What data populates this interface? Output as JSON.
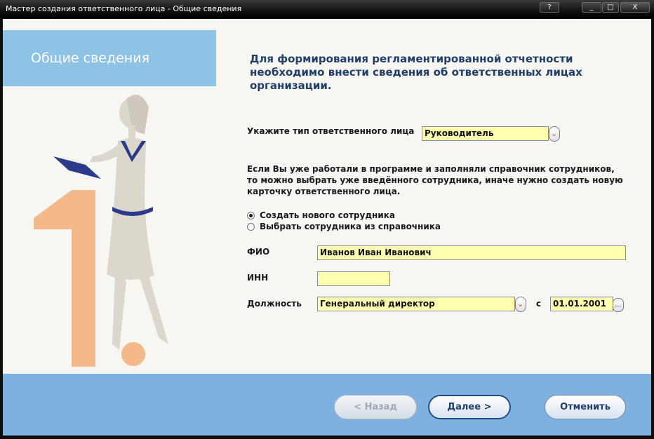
{
  "window": {
    "title": "Мастер создания ответственного лица - Общие сведения",
    "help_label": "?",
    "min_label": "_",
    "max_label": "□",
    "close_label": "X"
  },
  "header": {
    "title": "Общие сведения"
  },
  "intro": {
    "text": "Для формирования регламентированной отчетности необходимо внести сведения об ответственных лицах организации."
  },
  "responsible_type": {
    "label": "Укажите тип ответственного лица",
    "value": "Руководитель"
  },
  "hint": {
    "text": "Если Вы уже работали в программе и заполняли справочник сотрудников, то можно выбрать уже введённого сотрудника, иначе нужно создать новую карточку ответственного лица."
  },
  "options": [
    {
      "label": "Создать нового сотрудника",
      "checked": true
    },
    {
      "label": "Выбрать сотрудника из справочника",
      "checked": false
    }
  ],
  "fio": {
    "label": "ФИО",
    "value": "Иванов Иван Иванович"
  },
  "inn": {
    "label": "ИНН",
    "value": ""
  },
  "position": {
    "label": "Должность",
    "value": "Генеральный директор",
    "since_label": "с",
    "since_value": "01.01.2001",
    "ellipsis": "..."
  },
  "buttons": {
    "back": "< Назад",
    "next": "Далее >",
    "cancel": "Отменить"
  },
  "colors": {
    "header_box": "#8fc3e6",
    "footer": "#7eb1df",
    "field_bg": "#ffffb0",
    "numeral": "#f4b98a"
  }
}
